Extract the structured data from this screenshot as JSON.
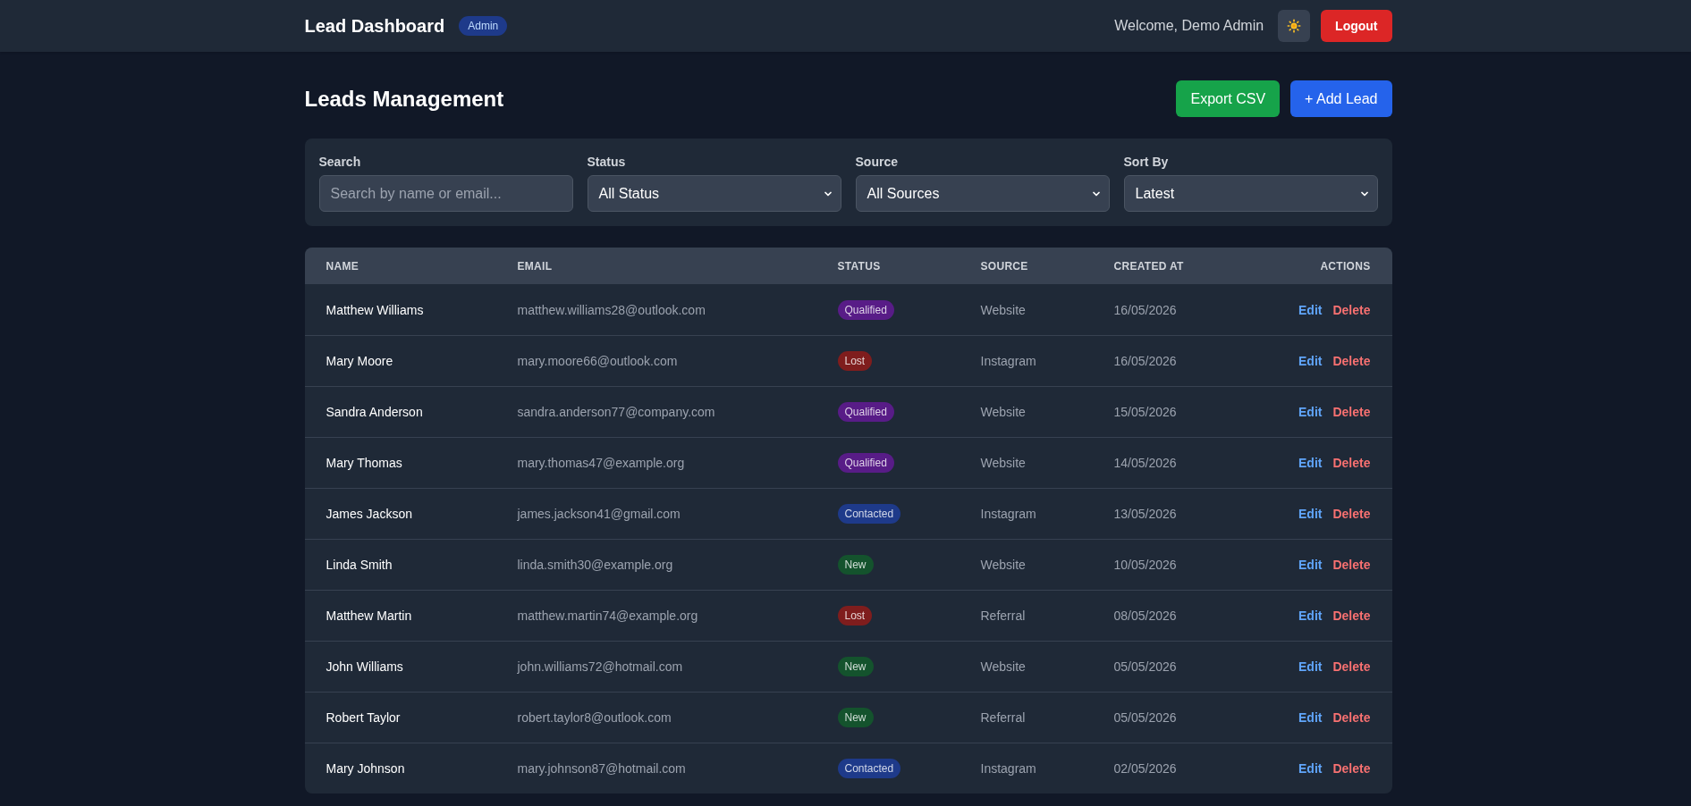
{
  "header": {
    "title": "Lead Dashboard",
    "role_badge": "Admin",
    "welcome": "Welcome, Demo Admin",
    "logout_button": "Logout"
  },
  "page": {
    "title": "Leads Management",
    "buttons": [
      {
        "label": "Export CSV",
        "kind": "export"
      },
      {
        "label": "+ Add Lead",
        "kind": "add"
      }
    ]
  },
  "filters": [
    {
      "label": "Search",
      "kind": "text",
      "placeholder": "Search by name or email..."
    },
    {
      "label": "Status",
      "kind": "select",
      "value": "All Status"
    },
    {
      "label": "Source",
      "kind": "select",
      "value": "All Sources"
    },
    {
      "label": "Sort By",
      "kind": "select",
      "value": "Latest"
    }
  ],
  "table": {
    "columns": [
      "NAME",
      "EMAIL",
      "STATUS",
      "SOURCE",
      "CREATED AT",
      "ACTIONS"
    ],
    "rows": [
      {
        "name": "Matthew Williams",
        "email": "matthew.williams28@outlook.com",
        "status": {
          "label": "Qualified",
          "color": "#581c87"
        },
        "source": "Website",
        "created_at": "16/05/2026",
        "actions": [
          {
            "label": "Edit",
            "kind": "edit"
          },
          {
            "label": "Delete",
            "kind": "delete"
          }
        ]
      },
      {
        "name": "Mary Moore",
        "email": "mary.moore66@outlook.com",
        "status": {
          "label": "Lost",
          "color": "#7f1d1d"
        },
        "source": "Instagram",
        "created_at": "16/05/2026",
        "actions": [
          {
            "label": "Edit",
            "kind": "edit"
          },
          {
            "label": "Delete",
            "kind": "delete"
          }
        ]
      },
      {
        "name": "Sandra Anderson",
        "email": "sandra.anderson77@company.com",
        "status": {
          "label": "Qualified",
          "color": "#581c87"
        },
        "source": "Website",
        "created_at": "15/05/2026",
        "actions": [
          {
            "label": "Edit",
            "kind": "edit"
          },
          {
            "label": "Delete",
            "kind": "delete"
          }
        ]
      },
      {
        "name": "Mary Thomas",
        "email": "mary.thomas47@example.org",
        "status": {
          "label": "Qualified",
          "color": "#581c87"
        },
        "source": "Website",
        "created_at": "14/05/2026",
        "actions": [
          {
            "label": "Edit",
            "kind": "edit"
          },
          {
            "label": "Delete",
            "kind": "delete"
          }
        ]
      },
      {
        "name": "James Jackson",
        "email": "james.jackson41@gmail.com",
        "status": {
          "label": "Contacted",
          "color": "#1e3a8a"
        },
        "source": "Instagram",
        "created_at": "13/05/2026",
        "actions": [
          {
            "label": "Edit",
            "kind": "edit"
          },
          {
            "label": "Delete",
            "kind": "delete"
          }
        ]
      },
      {
        "name": "Linda Smith",
        "email": "linda.smith30@example.org",
        "status": {
          "label": "New",
          "color": "#14532d"
        },
        "source": "Website",
        "created_at": "10/05/2026",
        "actions": [
          {
            "label": "Edit",
            "kind": "edit"
          },
          {
            "label": "Delete",
            "kind": "delete"
          }
        ]
      },
      {
        "name": "Matthew Martin",
        "email": "matthew.martin74@example.org",
        "status": {
          "label": "Lost",
          "color": "#7f1d1d"
        },
        "source": "Referral",
        "created_at": "08/05/2026",
        "actions": [
          {
            "label": "Edit",
            "kind": "edit"
          },
          {
            "label": "Delete",
            "kind": "delete"
          }
        ]
      },
      {
        "name": "John Williams",
        "email": "john.williams72@hotmail.com",
        "status": {
          "label": "New",
          "color": "#14532d"
        },
        "source": "Website",
        "created_at": "05/05/2026",
        "actions": [
          {
            "label": "Edit",
            "kind": "edit"
          },
          {
            "label": "Delete",
            "kind": "delete"
          }
        ]
      },
      {
        "name": "Robert Taylor",
        "email": "robert.taylor8@outlook.com",
        "status": {
          "label": "New",
          "color": "#14532d"
        },
        "source": "Referral",
        "created_at": "05/05/2026",
        "actions": [
          {
            "label": "Edit",
            "kind": "edit"
          },
          {
            "label": "Delete",
            "kind": "delete"
          }
        ]
      },
      {
        "name": "Mary Johnson",
        "email": "mary.johnson87@hotmail.com",
        "status": {
          "label": "Contacted",
          "color": "#1e3a8a"
        },
        "source": "Instagram",
        "created_at": "02/05/2026",
        "actions": [
          {
            "label": "Edit",
            "kind": "edit"
          },
          {
            "label": "Delete",
            "kind": "delete"
          }
        ]
      }
    ]
  }
}
